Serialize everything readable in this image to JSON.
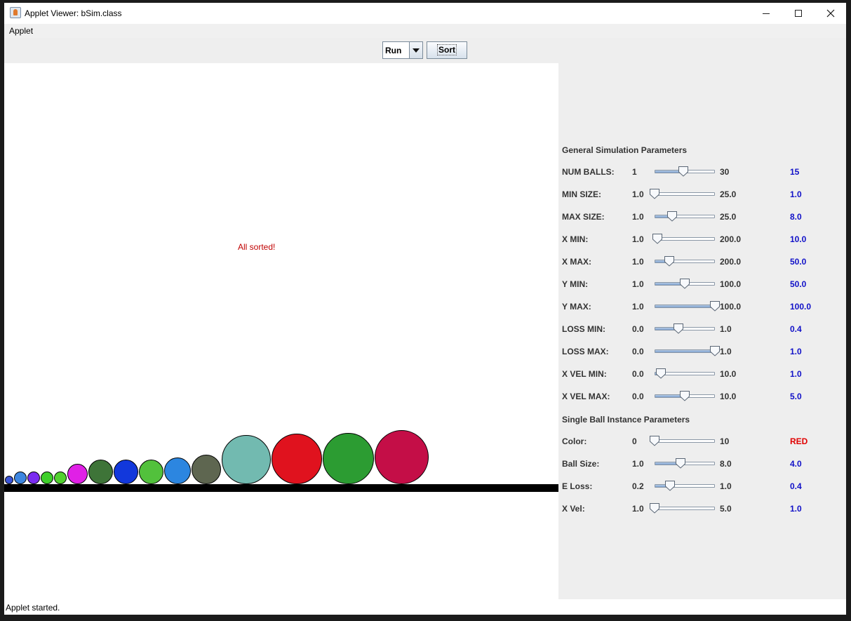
{
  "window": {
    "title": "Applet Viewer: bSim.class"
  },
  "menu": {
    "applet": "Applet"
  },
  "toolbar": {
    "mode": "Run",
    "sort_label": "Sort"
  },
  "canvas": {
    "message": "All sorted!",
    "balls": [
      {
        "diameter": 12,
        "color": "#3b55d9"
      },
      {
        "diameter": 18,
        "color": "#3d86e0"
      },
      {
        "diameter": 18,
        "color": "#7a2cf0"
      },
      {
        "diameter": 18,
        "color": "#3ecf2a"
      },
      {
        "diameter": 18,
        "color": "#52d12f"
      },
      {
        "diameter": 29,
        "color": "#e020e6"
      },
      {
        "diameter": 35,
        "color": "#3e7438"
      },
      {
        "diameter": 35,
        "color": "#1238dc"
      },
      {
        "diameter": 35,
        "color": "#52c13c"
      },
      {
        "diameter": 38,
        "color": "#2c86e0"
      },
      {
        "diameter": 42,
        "color": "#5e6650"
      },
      {
        "diameter": 70,
        "color": "#72bab0"
      },
      {
        "diameter": 72,
        "color": "#e0121e"
      },
      {
        "diameter": 73,
        "color": "#2c9c32"
      },
      {
        "diameter": 77,
        "color": "#c40e47"
      }
    ]
  },
  "general": {
    "title": "General Simulation Parameters",
    "params": [
      {
        "label": "NUM BALLS:",
        "min": "1",
        "max": "30",
        "value": "15",
        "fraction": 0.48
      },
      {
        "label": "MIN SIZE:",
        "min": "1.0",
        "max": "25.0",
        "value": "1.0",
        "fraction": 0.0
      },
      {
        "label": "MAX SIZE:",
        "min": "1.0",
        "max": "25.0",
        "value": "8.0",
        "fraction": 0.29
      },
      {
        "label": "X MIN:",
        "min": "1.0",
        "max": "200.0",
        "value": "10.0",
        "fraction": 0.045
      },
      {
        "label": "X MAX:",
        "min": "1.0",
        "max": "200.0",
        "value": "50.0",
        "fraction": 0.246
      },
      {
        "label": "Y MIN:",
        "min": "1.0",
        "max": "100.0",
        "value": "50.0",
        "fraction": 0.495
      },
      {
        "label": "Y MAX:",
        "min": "1.0",
        "max": "100.0",
        "value": "100.0",
        "fraction": 1.0
      },
      {
        "label": "LOSS MIN:",
        "min": "0.0",
        "max": "1.0",
        "value": "0.4",
        "fraction": 0.4
      },
      {
        "label": "LOSS MAX:",
        "min": "0.0",
        "max": "1.0",
        "value": "1.0",
        "fraction": 1.0
      },
      {
        "label": "X VEL MIN:",
        "min": "0.0",
        "max": "10.0",
        "value": "1.0",
        "fraction": 0.1
      },
      {
        "label": "X VEL MAX:",
        "min": "0.0",
        "max": "10.0",
        "value": "5.0",
        "fraction": 0.5
      }
    ]
  },
  "single": {
    "title": "Single Ball Instance Parameters",
    "params": [
      {
        "label": "Color:",
        "min": "0",
        "max": "10",
        "value": "RED",
        "fraction": 0.0,
        "value_color": "#e00000"
      },
      {
        "label": "Ball Size:",
        "min": "1.0",
        "max": "8.0",
        "value": "4.0",
        "fraction": 0.43
      },
      {
        "label": "E Loss:",
        "min": "0.2",
        "max": "1.0",
        "value": "0.4",
        "fraction": 0.25
      },
      {
        "label": "X Vel:",
        "min": "1.0",
        "max": "5.0",
        "value": "1.0",
        "fraction": 0.0
      }
    ]
  },
  "status": {
    "text": "Applet started."
  }
}
